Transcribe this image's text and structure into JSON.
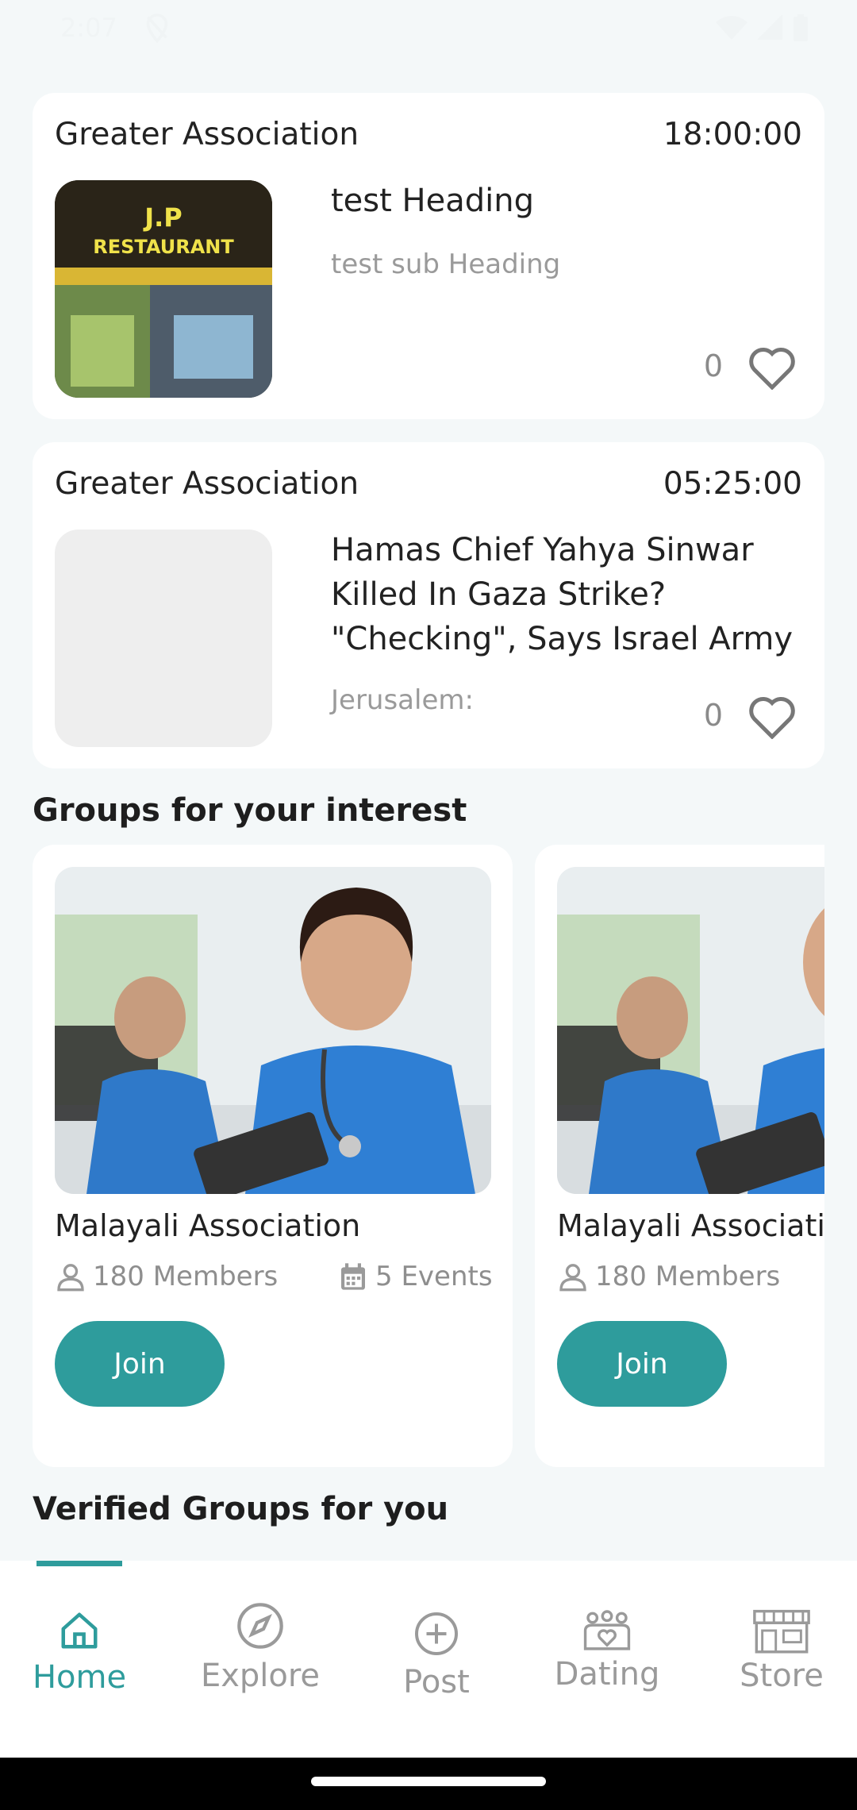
{
  "status_bar": {
    "time": "2:07"
  },
  "feed": [
    {
      "association": "Greater Association",
      "time": "18:00:00",
      "heading": "test Heading",
      "sub_heading": "test sub Heading",
      "likes": "0",
      "image_sign_text": "J.P RESTAURANT"
    },
    {
      "association": "Greater Association",
      "time": "05:25:00",
      "heading": "Hamas Chief Yahya Sinwar Killed In Gaza Strike? \"Checking\", Says Israel Army",
      "sub_heading": "Jerusalem:",
      "likes": "0"
    }
  ],
  "groups_section": {
    "title": "Groups for your interest",
    "groups": [
      {
        "name": "Malayali Association",
        "members": "180 Members",
        "events": "5 Events",
        "join_label": "Join"
      },
      {
        "name": "Malayali Association",
        "members": "180 Members",
        "join_label": "Join"
      }
    ]
  },
  "verified_section": {
    "title": "Verified Groups for you"
  },
  "bottom_nav": {
    "active": "Home",
    "items": [
      {
        "label": "Home",
        "icon": "home-icon"
      },
      {
        "label": "Explore",
        "icon": "compass-icon"
      },
      {
        "label": "Post",
        "icon": "plus-circle-icon"
      },
      {
        "label": "Dating",
        "icon": "dating-icon"
      },
      {
        "label": "Store",
        "icon": "store-icon"
      }
    ]
  },
  "colors": {
    "accent": "#2e9c9c",
    "background": "#f4f8f9",
    "card": "#ffffff",
    "muted": "#9a9a9a"
  }
}
